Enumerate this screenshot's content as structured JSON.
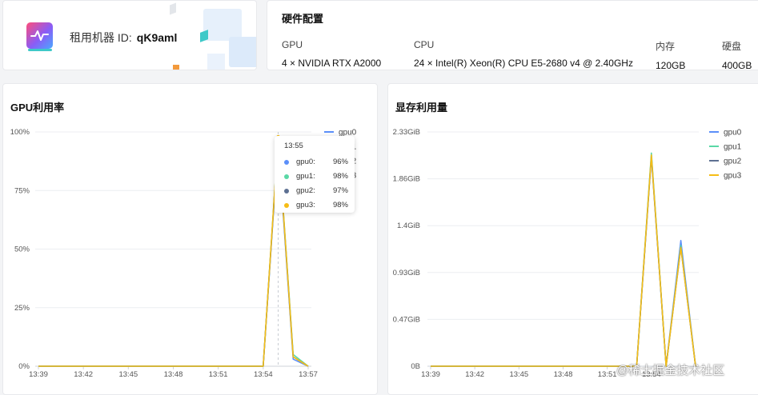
{
  "machine": {
    "label": "租用机器 ID:",
    "id": "qK9aml"
  },
  "hardware": {
    "title": "硬件配置",
    "columns": [
      {
        "key": "GPU",
        "value": "4 × NVIDIA RTX A2000"
      },
      {
        "key": "CPU",
        "value": "24 × Intel(R) Xeon(R) CPU E5-2680 v4 @ 2.40GHz"
      },
      {
        "key": "内存",
        "value": "120GB"
      },
      {
        "key": "硬盘",
        "value": "400GB"
      }
    ]
  },
  "gpu_chart": {
    "title": "GPU利用率",
    "tooltip": {
      "time": "13:55",
      "rows": [
        {
          "name": "gpu0:",
          "value": "96%",
          "color": "#5b8ff9"
        },
        {
          "name": "gpu1:",
          "value": "98%",
          "color": "#5ad8a6"
        },
        {
          "name": "gpu2:",
          "value": "97%",
          "color": "#5d7092"
        },
        {
          "name": "gpu3:",
          "value": "98%",
          "color": "#f6bd16"
        }
      ]
    }
  },
  "mem_chart": {
    "title": "显存利用量"
  },
  "watermark": "@稀土掘金技术社区",
  "chart_data": [
    {
      "type": "line",
      "title": "GPU利用率",
      "x": [
        "13:39",
        "13:40",
        "13:41",
        "13:42",
        "13:43",
        "13:44",
        "13:45",
        "13:46",
        "13:47",
        "13:48",
        "13:49",
        "13:50",
        "13:51",
        "13:52",
        "13:53",
        "13:54",
        "13:55",
        "13:56",
        "13:57"
      ],
      "xticks": [
        "13:39",
        "13:42",
        "13:45",
        "13:48",
        "13:51",
        "13:54",
        "13:57"
      ],
      "ytick_labels": [
        "0%",
        "25%",
        "50%",
        "75%",
        "100%"
      ],
      "ylim": [
        0,
        100
      ],
      "legend": "top-right",
      "series": [
        {
          "name": "gpu0",
          "color": "#5b8ff9",
          "values": [
            0,
            0,
            0,
            0,
            0,
            0,
            0,
            0,
            0,
            0,
            0,
            0,
            0,
            0,
            0,
            0,
            96,
            3,
            0
          ]
        },
        {
          "name": "gpu1",
          "color": "#5ad8a6",
          "values": [
            0,
            0,
            0,
            0,
            0,
            0,
            0,
            0,
            0,
            0,
            0,
            0,
            0,
            0,
            0,
            0,
            98,
            5,
            0
          ]
        },
        {
          "name": "gpu2",
          "color": "#5d7092",
          "values": [
            0,
            0,
            0,
            0,
            0,
            0,
            0,
            0,
            0,
            0,
            0,
            0,
            0,
            0,
            0,
            0,
            97,
            4,
            0
          ]
        },
        {
          "name": "gpu3",
          "color": "#f6bd16",
          "values": [
            0,
            0,
            0,
            0,
            0,
            0,
            0,
            0,
            0,
            0,
            0,
            0,
            0,
            0,
            0,
            0,
            98,
            4,
            0
          ]
        }
      ]
    },
    {
      "type": "line",
      "title": "显存利用量",
      "x": [
        "13:39",
        "13:40",
        "13:41",
        "13:42",
        "13:43",
        "13:44",
        "13:45",
        "13:46",
        "13:47",
        "13:48",
        "13:49",
        "13:50",
        "13:51",
        "13:52",
        "13:53",
        "13:54",
        "13:55",
        "13:56",
        "13:57"
      ],
      "xticks": [
        "13:39",
        "13:42",
        "13:45",
        "13:48",
        "13:51",
        "13:54"
      ],
      "ytick_labels": [
        "0B",
        "0.47GiB",
        "0.93GiB",
        "1.4GiB",
        "1.86GiB",
        "2.33GiB"
      ],
      "ylim": [
        0,
        2.33
      ],
      "legend": "top-right",
      "series": [
        {
          "name": "gpu0",
          "color": "#5b8ff9",
          "values": [
            0,
            0,
            0,
            0,
            0,
            0,
            0,
            0,
            0,
            0,
            0,
            0,
            0,
            0,
            0,
            2.1,
            0,
            1.25,
            0
          ]
        },
        {
          "name": "gpu1",
          "color": "#5ad8a6",
          "values": [
            0,
            0,
            0,
            0,
            0,
            0,
            0,
            0,
            0,
            0,
            0,
            0,
            0,
            0,
            0,
            2.12,
            0,
            1.2,
            0
          ]
        },
        {
          "name": "gpu2",
          "color": "#5d7092",
          "values": [
            0,
            0,
            0,
            0,
            0,
            0,
            0,
            0,
            0,
            0,
            0,
            0,
            0,
            0,
            0,
            2.08,
            0,
            1.18,
            0
          ]
        },
        {
          "name": "gpu3",
          "color": "#f6bd16",
          "values": [
            0,
            0,
            0,
            0,
            0,
            0,
            0,
            0,
            0,
            0,
            0,
            0,
            0,
            0,
            0,
            2.1,
            0,
            1.18,
            0
          ]
        }
      ]
    }
  ]
}
